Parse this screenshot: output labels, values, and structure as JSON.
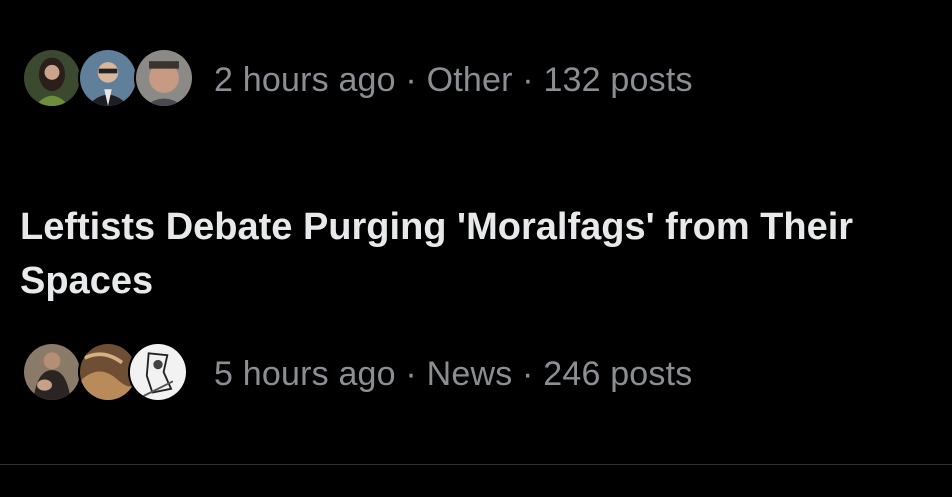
{
  "trends": [
    {
      "meta": "2 hours ago · Other · 132 posts"
    },
    {
      "title": "Leftists Debate Purging 'Moralfags' from Their Spaces",
      "meta": "5 hours ago · News · 246 posts"
    }
  ]
}
